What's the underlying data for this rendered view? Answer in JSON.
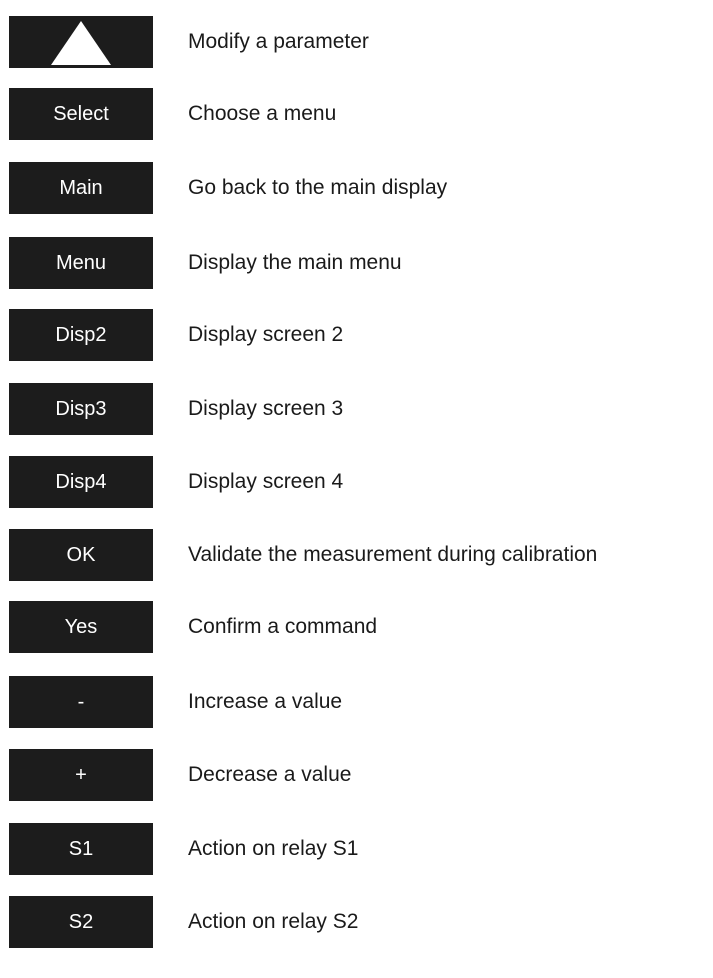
{
  "keys": [
    {
      "label": "",
      "icon": "triangle-up-icon",
      "description": "Modify a parameter"
    },
    {
      "label": "Select",
      "description": "Choose a menu"
    },
    {
      "label": "Main",
      "description": "Go back to the main display"
    },
    {
      "label": "Menu",
      "description": "Display the main menu"
    },
    {
      "label": "Disp2",
      "description": "Display screen 2"
    },
    {
      "label": "Disp3",
      "description": "Display screen 3"
    },
    {
      "label": "Disp4",
      "description": "Display screen 4"
    },
    {
      "label": "OK",
      "description": "Validate the measurement during calibration"
    },
    {
      "label": "Yes",
      "description": "Confirm a command"
    },
    {
      "label": "-",
      "description": "Increase a value"
    },
    {
      "label": "+",
      "description": "Decrease a value"
    },
    {
      "label": "S1",
      "description": "Action on relay S1"
    },
    {
      "label": "S2",
      "description": "Action on relay S2"
    }
  ],
  "colors": {
    "key_background": "#1c1c1c",
    "key_text": "#ffffff",
    "description_text": "#1a1a1a",
    "page_background": "#ffffff"
  }
}
